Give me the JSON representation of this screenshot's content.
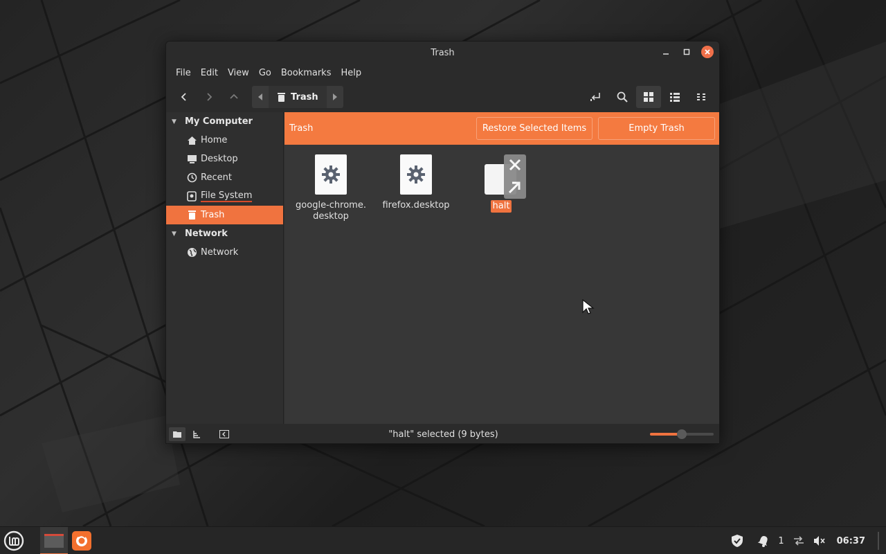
{
  "window": {
    "title": "Trash",
    "controls": [
      "minimize-icon",
      "maximize-icon",
      "close-icon"
    ]
  },
  "menubar": [
    "File",
    "Edit",
    "View",
    "Go",
    "Bookmarks",
    "Help"
  ],
  "pathbar": {
    "current": "Trash"
  },
  "sidebar": {
    "sections": [
      {
        "title": "My Computer",
        "items": [
          {
            "label": "Home",
            "icon": "home-icon"
          },
          {
            "label": "Desktop",
            "icon": "desktop-icon"
          },
          {
            "label": "Recent",
            "icon": "clock-icon"
          },
          {
            "label": "File System",
            "icon": "drive-icon"
          },
          {
            "label": "Trash",
            "icon": "trash-icon",
            "selected": true
          }
        ]
      },
      {
        "title": "Network",
        "items": [
          {
            "label": "Network",
            "icon": "network-globe-icon"
          }
        ]
      }
    ]
  },
  "trashbar": {
    "label": "Trash",
    "restore_label": "Restore Selected Items",
    "empty_label": "Empty Trash"
  },
  "files": [
    {
      "name": "google-chrome.\ndesktop",
      "icon": "gear-icon"
    },
    {
      "name": "firefox.desktop",
      "icon": "gear-icon"
    },
    {
      "name": "halt",
      "icon": "blank-file-icon",
      "selected": true
    }
  ],
  "statusbar": {
    "text": "\"halt\" selected (9 bytes)",
    "zoom_fraction": 0.45
  },
  "panel": {
    "clock": "06:37",
    "notification_count": "1"
  },
  "colors": {
    "accent": "#f0733f",
    "trashbar": "#f47a40"
  }
}
